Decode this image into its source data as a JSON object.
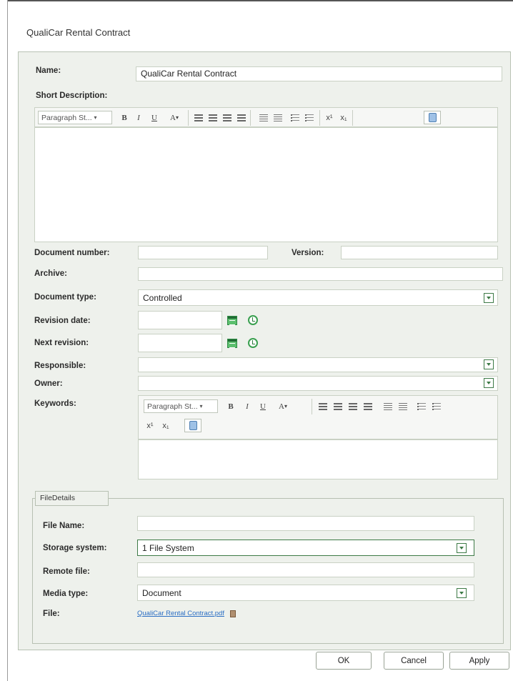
{
  "window": {
    "title": "QualiCar Rental Contract"
  },
  "form": {
    "name_label": "Name:",
    "name_value": "QualiCar Rental Contract",
    "short_description_label": "Short Description:",
    "document_number_label": "Document number:",
    "document_number_value": "",
    "version_label": "Version:",
    "version_value": "",
    "archive_label": "Archive:",
    "archive_value": "",
    "document_type_label": "Document type:",
    "document_type_value": "Controlled",
    "revision_date_label": "Revision date:",
    "revision_date_value": "",
    "next_revision_label": "Next revision:",
    "next_revision_value": "",
    "responsible_label": "Responsible:",
    "responsible_value": "",
    "owner_label": "Owner:",
    "owner_value": "",
    "keywords_label": "Keywords:"
  },
  "editor_toolbar": {
    "paragraph_style": "Paragraph St...",
    "bold": "B",
    "italic": "I",
    "underline": "U",
    "font_size": "A",
    "superscript": "x¹",
    "subscript": "x₁"
  },
  "file_details": {
    "tab_label": "FileDetails",
    "file_name_label": "File Name:",
    "file_name_value": "",
    "storage_system_label": "Storage system:",
    "storage_system_value": "1 File System",
    "remote_file_label": "Remote file:",
    "remote_file_value": "",
    "media_type_label": "Media type:",
    "media_type_value": "Document",
    "file_label": "File:",
    "file_link": "QualiCar Rental Contract.pdf"
  },
  "buttons": {
    "ok": "OK",
    "cancel": "Cancel",
    "apply": "Apply"
  },
  "colors": {
    "panel_bg": "#eef1ec",
    "accent_green": "#3d7a46",
    "link": "#2a6ec4"
  }
}
